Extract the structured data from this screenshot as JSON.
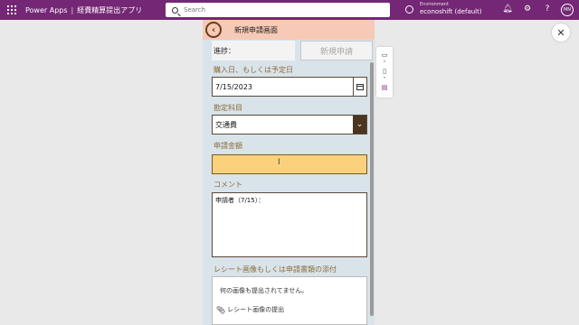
{
  "topbar": {
    "app_name": "Power Apps",
    "separator": "|",
    "app_title": "経費精算提出アプリ",
    "search_placeholder": "Search",
    "environment_label": "Environment",
    "environment_value": "econoshift (default)",
    "avatar_initials": "MN",
    "color": "#742774"
  },
  "form": {
    "screen_title": "新規申請画面",
    "status_label": "進捗：",
    "new_request_button": "新規申請",
    "purchase_date_label": "購入日、もしくは予定日",
    "purchase_date_value": "7/15/2023",
    "account_label": "勘定科目",
    "account_value": "交通費",
    "amount_label": "申請金額",
    "amount_value": "",
    "comment_label": "コメント",
    "comment_value": "申請者（7/15）：",
    "receipt_label": "レシート画像もしくは申請書類の添付",
    "receipt_empty": "何の画像も提出されてません。",
    "receipt_submit": "レシート画像の提出"
  },
  "icons": {
    "waffle": "waffle-icon",
    "search": "search-icon",
    "environment": "environment-icon",
    "bell": "bell-icon",
    "settings": "gear-icon",
    "help": "help-icon",
    "close": "close-icon",
    "back": "back-arrow-icon",
    "calendar": "calendar-icon",
    "dropdown": "chevron-down-icon",
    "paperclip": "paperclip-icon"
  }
}
